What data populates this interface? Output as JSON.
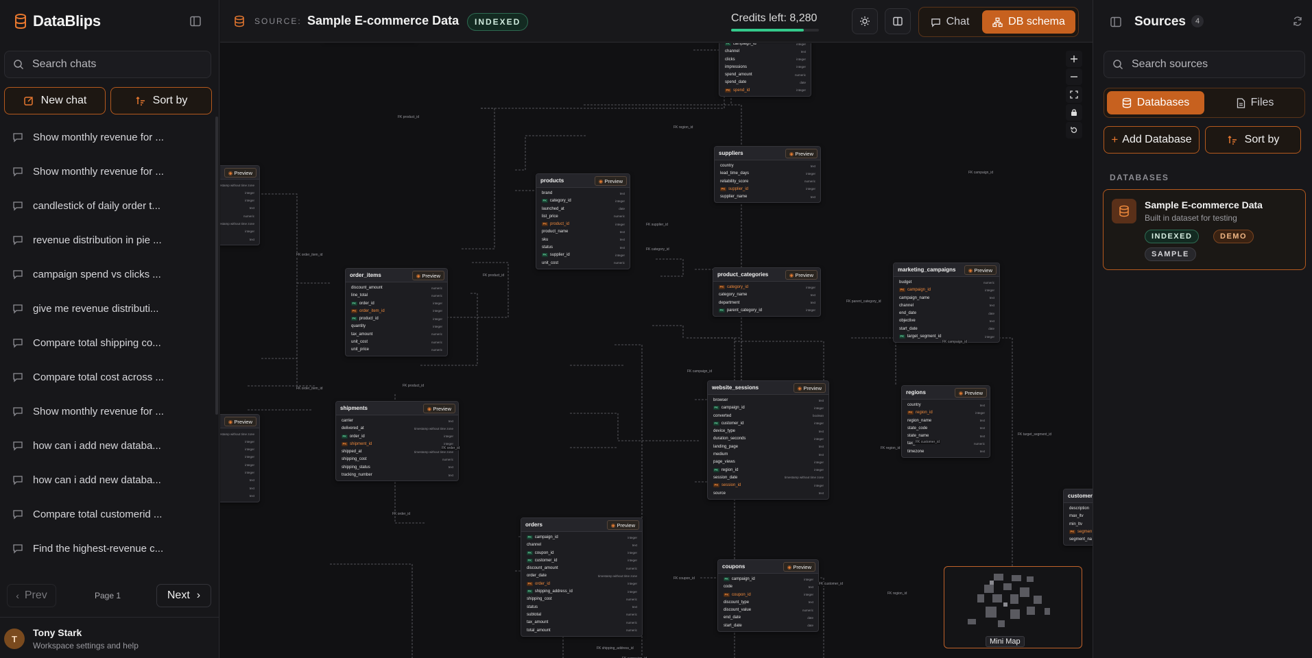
{
  "app": {
    "name": "DataBlips"
  },
  "left_sidebar": {
    "search_placeholder": "Search chats",
    "new_chat_label": "New chat",
    "sort_label": "Sort by",
    "chats": [
      "Show monthly revenue for ...",
      "Show monthly revenue for ...",
      "candlestick of daily order t...",
      "revenue distribution in pie ...",
      "campaign spend vs clicks ...",
      "give me revenue distributi...",
      "Compare total shipping co...",
      "Compare total cost across ...",
      "Show monthly revenue for ...",
      "how can i add new databa...",
      "how can i add new databa...",
      "Compare total customerid ...",
      "Find the highest-revenue c..."
    ],
    "pager": {
      "prev": "Prev",
      "page": "Page 1",
      "next": "Next"
    },
    "user": {
      "initial": "T",
      "name": "Tony Stark",
      "subtitle": "Workspace settings and help"
    }
  },
  "topbar": {
    "source_label": "SOURCE:",
    "source_name": "Sample E-commerce Data",
    "source_badge": "INDEXED",
    "credits_text": "Credits left: 8,280",
    "credits_fraction": 0.83,
    "chat_label": "Chat",
    "schema_label": "DB schema"
  },
  "canvas": {
    "minimap_label": "Mini Map",
    "preview_label": "Preview",
    "edge_labels": [
      "FK product_id",
      "FK region_id",
      "FK campaign_id",
      "FK order_item_id",
      "FK order_item_id",
      "FK product_id",
      "FK product_id",
      "FK supplier_id",
      "FK category_id",
      "FK parent_category_id",
      "FK campaign_id",
      "FK order_id",
      "FK order_id",
      "FK campaign_id",
      "FK region_id",
      "FK target_segment_id",
      "FK coupon_id",
      "FK shipping_address_id",
      "FK customer_id",
      "FK region_id",
      "FK campaign_id",
      "FK customer_id"
    ],
    "tables": [
      {
        "name": "",
        "x": 0,
        "y": 0,
        "rows": []
      },
      {
        "name": "products",
        "rows": [
          {
            "k": "",
            "n": "brand",
            "t": "text"
          },
          {
            "k": "FK",
            "n": "category_id",
            "t": "integer"
          },
          {
            "k": "",
            "n": "launched_at",
            "t": "date"
          },
          {
            "k": "",
            "n": "list_price",
            "t": "numeric"
          },
          {
            "k": "PK",
            "n": "product_id",
            "t": "integer"
          },
          {
            "k": "",
            "n": "product_name",
            "t": "text"
          },
          {
            "k": "",
            "n": "sku",
            "t": "text"
          },
          {
            "k": "",
            "n": "status",
            "t": "text"
          },
          {
            "k": "FK",
            "n": "supplier_id",
            "t": "integer"
          },
          {
            "k": "",
            "n": "unit_cost",
            "t": "numeric"
          }
        ]
      },
      {
        "name": "suppliers",
        "rows": [
          {
            "k": "",
            "n": "country",
            "t": "text"
          },
          {
            "k": "",
            "n": "lead_time_days",
            "t": "integer"
          },
          {
            "k": "",
            "n": "reliability_score",
            "t": "numeric"
          },
          {
            "k": "PK",
            "n": "supplier_id",
            "t": "integer"
          },
          {
            "k": "",
            "n": "supplier_name",
            "t": "text"
          }
        ]
      },
      {
        "name": "order_items",
        "rows": [
          {
            "k": "",
            "n": "discount_amount",
            "t": "numeric"
          },
          {
            "k": "",
            "n": "line_total",
            "t": "numeric"
          },
          {
            "k": "FK",
            "n": "order_id",
            "t": "integer"
          },
          {
            "k": "PK",
            "n": "order_item_id",
            "t": "integer"
          },
          {
            "k": "FK",
            "n": "product_id",
            "t": "integer"
          },
          {
            "k": "",
            "n": "quantity",
            "t": "integer"
          },
          {
            "k": "",
            "n": "tax_amount",
            "t": "numeric"
          },
          {
            "k": "",
            "n": "unit_cost",
            "t": "numeric"
          },
          {
            "k": "",
            "n": "unit_price",
            "t": "numeric"
          }
        ]
      },
      {
        "name": "product_categories",
        "rows": [
          {
            "k": "PK",
            "n": "category_id",
            "t": "integer"
          },
          {
            "k": "",
            "n": "category_name",
            "t": "text"
          },
          {
            "k": "",
            "n": "department",
            "t": "text"
          },
          {
            "k": "FK",
            "n": "parent_category_id",
            "t": "integer"
          }
        ]
      },
      {
        "name": "marketing_campaigns",
        "rows": [
          {
            "k": "",
            "n": "budget",
            "t": "numeric"
          },
          {
            "k": "PK",
            "n": "campaign_id",
            "t": "integer"
          },
          {
            "k": "",
            "n": "campaign_name",
            "t": "text"
          },
          {
            "k": "",
            "n": "channel",
            "t": "text"
          },
          {
            "k": "",
            "n": "end_date",
            "t": "date"
          },
          {
            "k": "",
            "n": "objective",
            "t": "text"
          },
          {
            "k": "",
            "n": "start_date",
            "t": "date"
          },
          {
            "k": "FK",
            "n": "target_segment_id",
            "t": "integer"
          }
        ]
      },
      {
        "name": "shipments",
        "rows": [
          {
            "k": "",
            "n": "carrier",
            "t": "text"
          },
          {
            "k": "",
            "n": "delivered_at",
            "t": "timestamp without time zone"
          },
          {
            "k": "FK",
            "n": "order_id",
            "t": "integer"
          },
          {
            "k": "PK",
            "n": "shipment_id",
            "t": "integer"
          },
          {
            "k": "",
            "n": "shipped_at",
            "t": "timestamp without time zone"
          },
          {
            "k": "",
            "n": "shipping_cost",
            "t": "numeric"
          },
          {
            "k": "",
            "n": "shipping_status",
            "t": "text"
          },
          {
            "k": "",
            "n": "tracking_number",
            "t": "text"
          }
        ]
      },
      {
        "name": "website_sessions",
        "rows": [
          {
            "k": "",
            "n": "browser",
            "t": "text"
          },
          {
            "k": "FK",
            "n": "campaign_id",
            "t": "integer"
          },
          {
            "k": "",
            "n": "converted",
            "t": "boolean"
          },
          {
            "k": "FK",
            "n": "customer_id",
            "t": "integer"
          },
          {
            "k": "",
            "n": "device_type",
            "t": "text"
          },
          {
            "k": "",
            "n": "duration_seconds",
            "t": "integer"
          },
          {
            "k": "",
            "n": "landing_page",
            "t": "text"
          },
          {
            "k": "",
            "n": "medium",
            "t": "text"
          },
          {
            "k": "",
            "n": "page_views",
            "t": "integer"
          },
          {
            "k": "FK",
            "n": "region_id",
            "t": "integer"
          },
          {
            "k": "",
            "n": "session_date",
            "t": "timestamp without time zone"
          },
          {
            "k": "PK",
            "n": "session_id",
            "t": "integer"
          },
          {
            "k": "",
            "n": "source",
            "t": "text"
          }
        ]
      },
      {
        "name": "regions",
        "rows": [
          {
            "k": "",
            "n": "country",
            "t": "text"
          },
          {
            "k": "PK",
            "n": "region_id",
            "t": "integer"
          },
          {
            "k": "",
            "n": "region_name",
            "t": "text"
          },
          {
            "k": "",
            "n": "state_code",
            "t": "text"
          },
          {
            "k": "",
            "n": "state_name",
            "t": "text"
          },
          {
            "k": "",
            "n": "tax_rate",
            "t": "numeric"
          },
          {
            "k": "",
            "n": "timezone",
            "t": "text"
          }
        ]
      },
      {
        "name": "orders",
        "rows": [
          {
            "k": "FK",
            "n": "campaign_id",
            "t": "integer"
          },
          {
            "k": "",
            "n": "channel",
            "t": "text"
          },
          {
            "k": "FK",
            "n": "coupon_id",
            "t": "integer"
          },
          {
            "k": "FK",
            "n": "customer_id",
            "t": "integer"
          },
          {
            "k": "",
            "n": "discount_amount",
            "t": "numeric"
          },
          {
            "k": "",
            "n": "order_date",
            "t": "timestamp without time zone"
          },
          {
            "k": "PK",
            "n": "order_id",
            "t": "integer"
          },
          {
            "k": "FK",
            "n": "shipping_address_id",
            "t": "integer"
          },
          {
            "k": "",
            "n": "shipping_cost",
            "t": "numeric"
          },
          {
            "k": "",
            "n": "status",
            "t": "text"
          },
          {
            "k": "",
            "n": "subtotal",
            "t": "numeric"
          },
          {
            "k": "",
            "n": "tax_amount",
            "t": "numeric"
          },
          {
            "k": "",
            "n": "total_amount",
            "t": "numeric"
          }
        ]
      },
      {
        "name": "coupons",
        "rows": [
          {
            "k": "FK",
            "n": "campaign_id",
            "t": "integer"
          },
          {
            "k": "",
            "n": "code",
            "t": "text"
          },
          {
            "k": "PK",
            "n": "coupon_id",
            "t": "integer"
          },
          {
            "k": "",
            "n": "discount_type",
            "t": "text"
          },
          {
            "k": "",
            "n": "discount_value",
            "t": "numeric"
          },
          {
            "k": "",
            "n": "end_date",
            "t": "date"
          },
          {
            "k": "",
            "n": "start_date",
            "t": "date"
          }
        ]
      },
      {
        "name": "",
        "rows": [
          {
            "k": "FK",
            "n": "campaign_id",
            "t": "integer"
          },
          {
            "k": "",
            "n": "channel",
            "t": "text"
          },
          {
            "k": "",
            "n": "clicks",
            "t": "integer"
          },
          {
            "k": "",
            "n": "impressions",
            "t": "integer"
          },
          {
            "k": "",
            "n": "spend_amount",
            "t": "numeric"
          },
          {
            "k": "",
            "n": "spend_date",
            "t": "date"
          },
          {
            "k": "PK",
            "n": "spend_id",
            "t": "integer"
          }
        ]
      },
      {
        "name": "customer_",
        "rows": [
          {
            "k": "",
            "n": "description",
            "t": ""
          },
          {
            "k": "",
            "n": "max_ltv",
            "t": ""
          },
          {
            "k": "",
            "n": "min_ltv",
            "t": ""
          },
          {
            "k": "PK",
            "n": "segmen",
            "t": ""
          },
          {
            "k": "",
            "n": "segment_na",
            "t": ""
          }
        ]
      },
      {
        "name": "",
        "rows": [
          {
            "k": "",
            "n": "",
            "t": "timestamp without time zone"
          },
          {
            "k": "",
            "n": "",
            "t": "integer"
          },
          {
            "k": "",
            "n": "",
            "t": "integer"
          },
          {
            "k": "",
            "n": "",
            "t": "text"
          },
          {
            "k": "",
            "n": "",
            "t": "numeric"
          },
          {
            "k": "",
            "n": "",
            "t": "timestamp without time zone"
          },
          {
            "k": "",
            "n": "",
            "t": "integer"
          },
          {
            "k": "",
            "n": "",
            "t": "text"
          }
        ]
      },
      {
        "name": "",
        "rows": [
          {
            "k": "",
            "n": "",
            "t": "timestamp without time zone"
          },
          {
            "k": "",
            "n": "",
            "t": "integer"
          },
          {
            "k": "",
            "n": "",
            "t": "integer"
          },
          {
            "k": "",
            "n": "",
            "t": "integer"
          },
          {
            "k": "",
            "n": "",
            "t": "integer"
          },
          {
            "k": "",
            "n": "",
            "t": "integer"
          },
          {
            "k": "",
            "n": "",
            "t": "text"
          },
          {
            "k": "",
            "n": "",
            "t": "text"
          },
          {
            "k": "",
            "n": "",
            "t": "text"
          }
        ]
      }
    ]
  },
  "right_panel": {
    "title": "Sources",
    "count": "4",
    "search_placeholder": "Search sources",
    "tab_databases": "Databases",
    "tab_files": "Files",
    "add_database": "Add Database",
    "sort_label": "Sort by",
    "section_label": "DATABASES",
    "card": {
      "name": "Sample E-commerce Data",
      "description": "Built in dataset for testing",
      "badges": [
        "INDEXED",
        "DEMO",
        "SAMPLE"
      ]
    }
  },
  "colors": {
    "accent": "#c7611f",
    "indexed": "#34c98b",
    "background": "#111113"
  }
}
